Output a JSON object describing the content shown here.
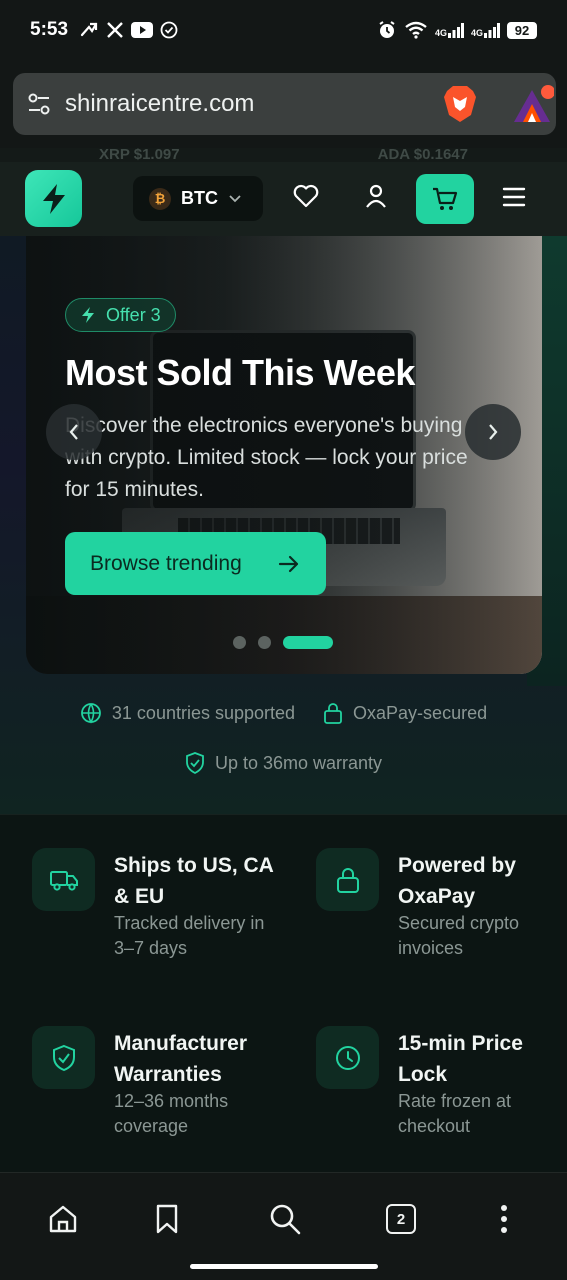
{
  "status_bar": {
    "time": "5:53",
    "net1": "4G",
    "net2": "4G",
    "battery": "92"
  },
  "browser": {
    "url": "shinraicentre.com",
    "tab_count": "2"
  },
  "ticker": {
    "items": [
      "XRP $1.097",
      "ADA $0.1647"
    ]
  },
  "site_header": {
    "currency_symbol": "₿",
    "currency": "BTC"
  },
  "hero": {
    "badge": "Offer 3",
    "title": "Most Sold This Week",
    "description": "Discover the electronics everyone's buying with crypto. Limited stock — lock your price for 15 minutes.",
    "cta": "Browse trending",
    "slide_count": 3,
    "active_slide": 3
  },
  "trust": {
    "countries": "31 countries supported",
    "secured": "OxaPay-secured",
    "warranty": "Up to 36mo warranty"
  },
  "features": [
    {
      "title": "Ships to US, CA & EU",
      "desc": "Tracked delivery in 3–7 days",
      "icon": "truck-icon"
    },
    {
      "title": "Powered by OxaPay",
      "desc": "Secured crypto invoices",
      "icon": "lock-icon"
    },
    {
      "title": "Manufacturer Warranties",
      "desc": "12–36 months coverage",
      "icon": "shield-check-icon"
    },
    {
      "title": "15-min Price Lock",
      "desc": "Rate frozen at checkout",
      "icon": "clock-icon"
    }
  ],
  "colors": {
    "accent": "#22d3a0",
    "background": "#0c1513",
    "muted_text": "#8b9794"
  }
}
